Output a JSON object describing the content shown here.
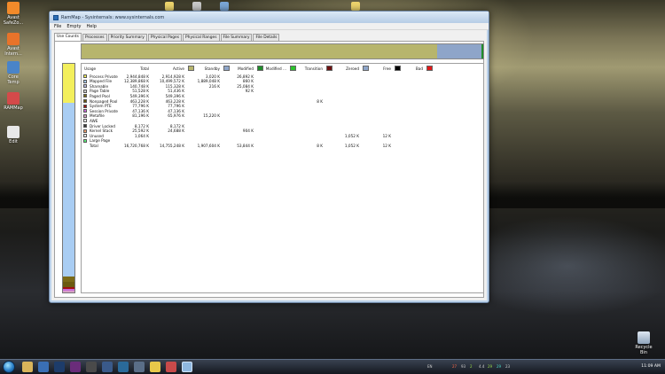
{
  "desktop": {
    "icons": [
      {
        "label": "Avast SafeZo...",
        "color": "#f28a2a"
      },
      {
        "label": "Avast Intern...",
        "color": "#e8732a"
      },
      {
        "label": "Core Temp",
        "color": "#4a84c8"
      },
      {
        "label": "RAMMap",
        "color": "#d44a4a"
      },
      {
        "label": "Edit",
        "color": "#e8e8e8"
      }
    ],
    "recycle_label": "Recycle Bin"
  },
  "window": {
    "title": "RamMap - Sysinternals: www.sysinternals.com",
    "menus": [
      "File",
      "Empty",
      "Help"
    ],
    "tabs": [
      "Use Counts",
      "Processes",
      "Priority Summary",
      "Physical Pages",
      "Physical Ranges",
      "File Summary",
      "File Details"
    ],
    "active_tab": "Use Counts",
    "columns": [
      "Usage",
      "Total",
      "Active",
      "Standby",
      "Modified",
      "Modified ...",
      "Transition",
      "Zeroed",
      "Free",
      "Bad"
    ],
    "column_colors": {
      "Active": "#b7b56d",
      "Standby": "#8ea5c9",
      "Modified": "#1f8d2a",
      "Modified ...": "#2bc22b",
      "Transition": "#6d1010",
      "Zeroed": "#8ea5c9",
      "Free": "#000000",
      "Bad": "#e11818"
    },
    "overview": [
      {
        "fraction": 0.885,
        "color": "#b7b56d"
      },
      {
        "fraction": 0.11,
        "color": "#8ea5c9"
      },
      {
        "fraction": 0.005,
        "color": "#1f8d2a"
      }
    ],
    "rows": [
      {
        "color": "#f3ef5c",
        "usage": "Process Private",
        "total": "2,944,848 K",
        "active": "2,914,928 K",
        "standby": "3,020 K",
        "modified": "26,892 K",
        "modified_np": "",
        "transition": "",
        "zeroed": "",
        "free": "",
        "bad": ""
      },
      {
        "color": "#a9cdf3",
        "usage": "Mapped File",
        "total": "12,389,868 K",
        "active": "10,499,572 K",
        "standby": "1,889,048 K",
        "modified": "860 K",
        "modified_np": "",
        "transition": "",
        "zeroed": "",
        "free": "",
        "bad": ""
      },
      {
        "color": "#b8b8e0",
        "usage": "Shareable",
        "total": "140,748 K",
        "active": "115,328 K",
        "standby": "216 K",
        "modified": "25,084 K",
        "modified_np": "",
        "transition": "",
        "zeroed": "",
        "free": "",
        "bad": ""
      },
      {
        "color": "#cfcfcf",
        "usage": "Page Table",
        "total": "51,528 K",
        "active": "51,436 K",
        "standby": "",
        "modified": "92 K",
        "modified_np": "",
        "transition": "",
        "zeroed": "",
        "free": "",
        "bad": ""
      },
      {
        "color": "#7b6a18",
        "usage": "Paged Pool",
        "total": "549,396 K",
        "active": "549,396 K",
        "standby": "",
        "modified": "",
        "modified_np": "",
        "transition": "",
        "zeroed": "",
        "free": "",
        "bad": ""
      },
      {
        "color": "#6b5a10",
        "usage": "Nonpaged Pool",
        "total": "463,228 K",
        "active": "463,228 K",
        "standby": "",
        "modified": "",
        "modified_np": "",
        "transition": "8 K",
        "zeroed": "",
        "free": "",
        "bad": ""
      },
      {
        "color": "#a01010",
        "usage": "System PTE",
        "total": "77,796 K",
        "active": "77,796 K",
        "standby": "",
        "modified": "",
        "modified_np": "",
        "transition": "",
        "zeroed": "",
        "free": "",
        "bad": ""
      },
      {
        "color": "#c86ad8",
        "usage": "Session Private",
        "total": "47,136 K",
        "active": "47,136 K",
        "standby": "",
        "modified": "",
        "modified_np": "",
        "transition": "",
        "zeroed": "",
        "free": "",
        "bad": ""
      },
      {
        "color": "#d8a0c8",
        "usage": "Metafile",
        "total": "81,196 K",
        "active": "65,976 K",
        "standby": "15,220 K",
        "modified": "",
        "modified_np": "",
        "transition": "",
        "zeroed": "",
        "free": "",
        "bad": ""
      },
      {
        "color": "#ffffff",
        "usage": "AWE",
        "total": "",
        "active": "",
        "standby": "",
        "modified": "",
        "modified_np": "",
        "transition": "",
        "zeroed": "",
        "free": "",
        "bad": ""
      },
      {
        "color": "#3a3a3a",
        "usage": "Driver Locked",
        "total": "8,172 K",
        "active": "8,172 K",
        "standby": "",
        "modified": "",
        "modified_np": "",
        "transition": "",
        "zeroed": "",
        "free": "",
        "bad": ""
      },
      {
        "color": "#f0a070",
        "usage": "Kernel Stack",
        "total": "25,592 K",
        "active": "24,688 K",
        "standby": "",
        "modified": "904 K",
        "modified_np": "",
        "transition": "",
        "zeroed": "",
        "free": "",
        "bad": ""
      },
      {
        "color": "#e8e8e8",
        "usage": "Unused",
        "total": "1,064 K",
        "active": "",
        "standby": "",
        "modified": "",
        "modified_np": "",
        "transition": "",
        "zeroed": "1,052 K",
        "free": "12 K",
        "bad": ""
      },
      {
        "color": "#5cf07a",
        "usage": "Large Page",
        "total": "",
        "active": "",
        "standby": "",
        "modified": "",
        "modified_np": "",
        "transition": "",
        "zeroed": "",
        "free": "",
        "bad": ""
      },
      {
        "color": "",
        "usage": "Total",
        "total": "16,720,768 K",
        "active": "14,755,248 K",
        "standby": "1,907,604 K",
        "modified": "53,844 K",
        "modified_np": "",
        "transition": "8 K",
        "zeroed": "1,052 K",
        "free": "12 K",
        "bad": ""
      }
    ],
    "vbar": [
      {
        "fraction": 0.17,
        "color": "#f3ef5c"
      },
      {
        "fraction": 0.76,
        "color": "#a9cdf3"
      },
      {
        "fraction": 0.025,
        "color": "#7b6a18"
      },
      {
        "fraction": 0.02,
        "color": "#6b5a10"
      },
      {
        "fraction": 0.008,
        "color": "#a01010"
      },
      {
        "fraction": 0.008,
        "color": "#c86ad8"
      },
      {
        "fraction": 0.009,
        "color": "#d8a0c8"
      }
    ]
  },
  "taskbar": {
    "tray_lang": "EN",
    "tray_values": [
      "27",
      "93",
      "2",
      "4.4",
      "29",
      "29",
      "23"
    ],
    "clock": "11:09 AM"
  }
}
